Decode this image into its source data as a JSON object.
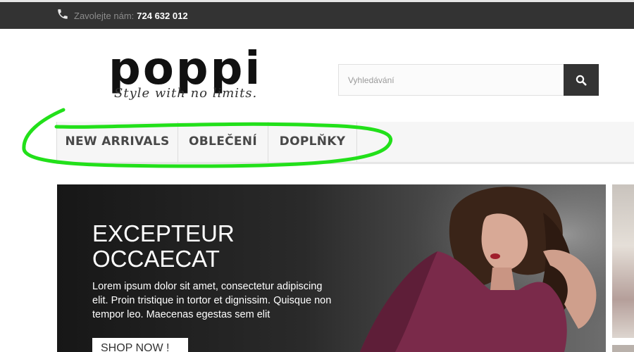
{
  "topbar": {
    "call_label": "Zavolejte nám:",
    "phone_number": "724 632 012"
  },
  "logo": {
    "name": "poppi",
    "tagline": "Style with no limits."
  },
  "search": {
    "placeholder": "Vyhledávání",
    "button_icon": "magnifier-icon"
  },
  "nav": {
    "items": [
      {
        "label": "NEW ARRIVALS"
      },
      {
        "label": "OBLEČENÍ"
      },
      {
        "label": "DOPLŇKY"
      }
    ]
  },
  "banner": {
    "title_line1": "EXCEPTEUR",
    "title_line2": "OCCAECAT",
    "text": "Lorem ipsum dolor sit amet, consectetur adipiscing elit. Proin tristique in tortor et dignissim. Quisque non tempor leo. Maecenas egestas sem elit",
    "button_label": "SHOP NOW !"
  },
  "colors": {
    "topbar_bg": "#333333",
    "search_button_bg": "#333333",
    "nav_bg": "#f6f6f6",
    "highlight": "#22e01a"
  }
}
